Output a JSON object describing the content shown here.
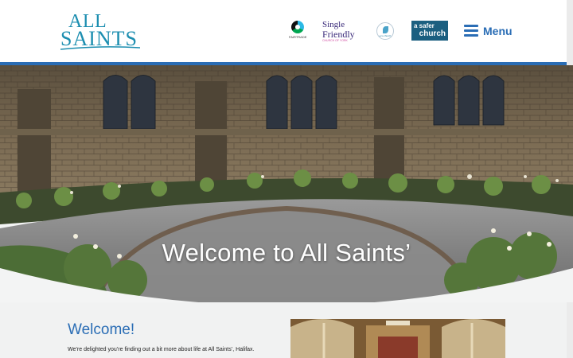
{
  "header": {
    "logo_line1": "ALL",
    "logo_line2": "SAINTS",
    "badges": {
      "fairtrade_caption": "FAIRTRADE",
      "single_friendly_line1": "Single",
      "single_friendly_line2": "Friendly",
      "single_friendly_tagline": "CHURCH OF YORK",
      "eco_church_caption": "eco church",
      "safer_church_line1": "a safer",
      "safer_church_line2": "church"
    },
    "menu_label": "Menu"
  },
  "hero": {
    "title": "Welcome to All Saints’"
  },
  "intro": {
    "heading": "Welcome!",
    "text": "We’re delighted you’re finding out a bit more about life at All Saints’, Halifax."
  },
  "colors": {
    "brand_blue": "#2a6db5",
    "logo_teal": "#1c8eb0",
    "safer_church_bg": "#1b5f80"
  },
  "icons": [
    "fairtrade-icon",
    "eco-church-icon",
    "hamburger-icon"
  ]
}
